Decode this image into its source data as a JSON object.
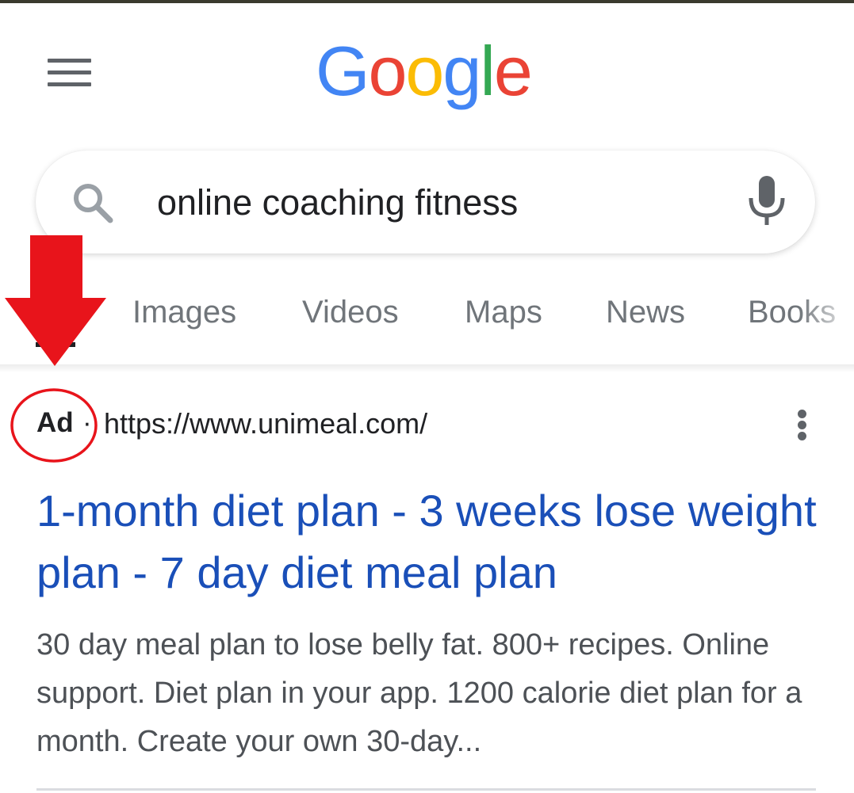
{
  "header": {
    "logo_text": "Google",
    "logo_colors": [
      "#4285F4",
      "#EA4335",
      "#FBBC05",
      "#4285F4",
      "#34A853",
      "#EA4335"
    ]
  },
  "search": {
    "query": "online coaching fitness",
    "placeholder": ""
  },
  "tabs": {
    "items": [
      {
        "label": "Images"
      },
      {
        "label": "Videos"
      },
      {
        "label": "Maps"
      },
      {
        "label": "News"
      },
      {
        "label": "Books"
      }
    ]
  },
  "result": {
    "ad_label": "Ad",
    "separator": "·",
    "url": "https://www.unimeal.com/",
    "title": "1-month diet plan - 3 weeks lose weight plan - 7 day diet meal plan",
    "description": "30 day meal plan to lose belly fat. 800+ recipes. Online support. Diet plan in your app. 1200 calorie diet plan for a month. Create your own 30-day..."
  },
  "annotation": {
    "color": "#E8141B",
    "shapes": [
      "down-arrow",
      "circle"
    ]
  },
  "colors": {
    "link": "#1a4fb8",
    "text": "#202124",
    "snippet": "#4d5156",
    "icon": "#5f6368"
  }
}
